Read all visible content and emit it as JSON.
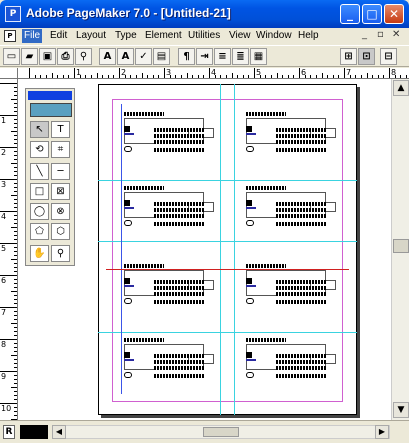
{
  "window": {
    "title": "Adobe PageMaker 7.0 - [Untitled-21]"
  },
  "window_buttons": {
    "minimize": "_",
    "maximize": "□",
    "close": "✕"
  },
  "menu": {
    "doc_icon": "P",
    "items": [
      "File",
      "Edit",
      "Layout",
      "Type",
      "Element",
      "Utilities",
      "View",
      "Window",
      "Help"
    ],
    "active_index": 0,
    "mdi": {
      "minimize": "_",
      "restore": "▫",
      "close": "✕"
    }
  },
  "toolbar": {
    "buttons": [
      {
        "name": "new-icon",
        "glyph": "▭"
      },
      {
        "name": "open-icon",
        "glyph": "▰"
      },
      {
        "name": "save-icon",
        "glyph": "▣"
      },
      {
        "name": "print-icon",
        "glyph": "⎙"
      },
      {
        "name": "find-icon",
        "glyph": "⚲"
      },
      {
        "name": "text-tool-icon",
        "glyph": "A"
      },
      {
        "name": "font-size-icon",
        "glyph": "A"
      },
      {
        "name": "spell-check-icon",
        "glyph": "✓"
      },
      {
        "name": "styles-icon",
        "glyph": "▤"
      },
      {
        "name": "paragraph-icon",
        "glyph": "¶"
      },
      {
        "name": "indent-icon",
        "glyph": "⇥"
      },
      {
        "name": "bullets-icon",
        "glyph": "≡"
      },
      {
        "name": "align-icon",
        "glyph": "≣"
      },
      {
        "name": "layout-icon",
        "glyph": "▦"
      },
      {
        "name": "place-icon",
        "glyph": "⊞"
      },
      {
        "name": "zoom-icon",
        "glyph": "⊡"
      },
      {
        "name": "preview-icon",
        "glyph": "⊟"
      }
    ]
  },
  "ruler": {
    "h_labels": [
      "1",
      "2",
      "3",
      "4",
      "5",
      "6",
      "7",
      "8"
    ],
    "v_labels": [
      "1",
      "2",
      "3",
      "4",
      "5",
      "6",
      "7",
      "8",
      "9",
      "10"
    ]
  },
  "toolbox": {
    "tools": [
      {
        "name": "pointer-tool-icon",
        "glyph": "↖"
      },
      {
        "name": "text-tool-icon",
        "glyph": "T"
      },
      {
        "name": "rotate-tool-icon",
        "glyph": "⟲"
      },
      {
        "name": "crop-tool-icon",
        "glyph": "⌗"
      },
      {
        "name": "line-tool-icon",
        "glyph": "╲"
      },
      {
        "name": "constrained-line-tool-icon",
        "glyph": "─"
      },
      {
        "name": "rectangle-tool-icon",
        "glyph": "□"
      },
      {
        "name": "rectangle-frame-tool-icon",
        "glyph": "⊠"
      },
      {
        "name": "ellipse-tool-icon",
        "glyph": "◯"
      },
      {
        "name": "ellipse-frame-tool-icon",
        "glyph": "⊗"
      },
      {
        "name": "polygon-tool-icon",
        "glyph": "⬠"
      },
      {
        "name": "polygon-frame-tool-icon",
        "glyph": "⬡"
      },
      {
        "name": "hand-tool-icon",
        "glyph": "✋"
      },
      {
        "name": "zoom-tool-icon",
        "glyph": "⚲"
      }
    ]
  },
  "status": {
    "page_label": "R"
  },
  "scroll": {
    "up": "▲",
    "down": "▼",
    "left": "◀",
    "right": "▶"
  },
  "colors": {
    "guide": "#3ad3e0",
    "margin": "#d060d0",
    "selection_line": "#d02020",
    "title_bar": "#0054E3"
  }
}
